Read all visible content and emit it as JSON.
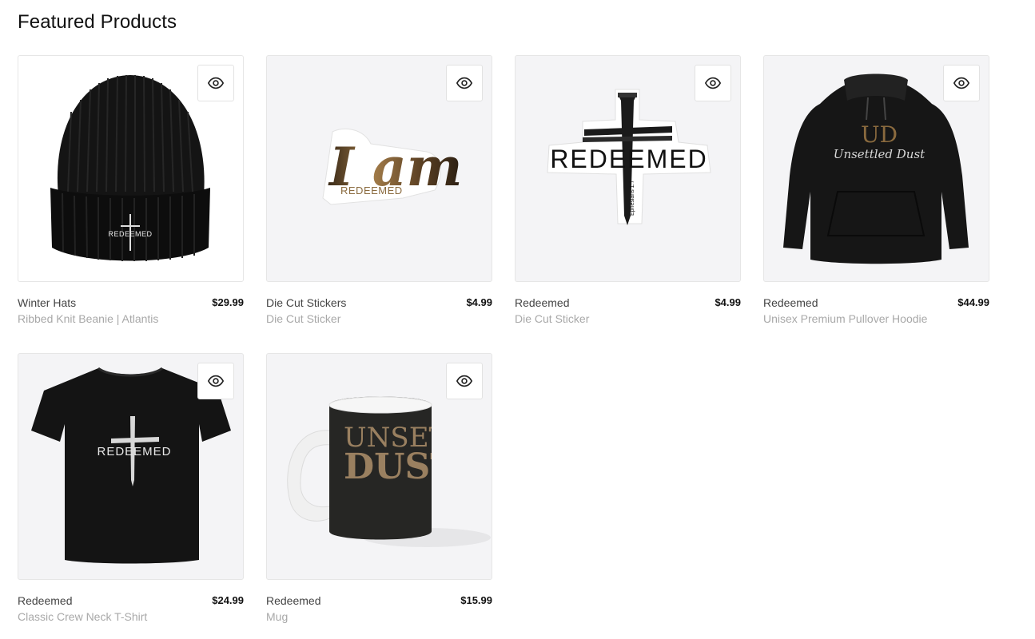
{
  "section": {
    "title": "Featured Products"
  },
  "quick_view_icon": "eye-icon",
  "products": [
    {
      "collection": "Winter Hats",
      "type": "Ribbed Knit Beanie | Atlantis",
      "price": "$29.99",
      "image": "black-beanie-redeemed",
      "art_text": "REDEEMED"
    },
    {
      "collection": "Die Cut Stickers",
      "type": "Die Cut Sticker",
      "price": "$4.99",
      "image": "i-am-redeemed-sticker",
      "art_text": "I am",
      "art_subtext": "REDEEMED"
    },
    {
      "collection": "Redeemed",
      "type": "Die Cut Sticker",
      "price": "$4.99",
      "image": "nail-cross-redeemed-sticker",
      "art_text": "REDEEMED",
      "art_subtext": "Ephesians 1:7"
    },
    {
      "collection": "Redeemed",
      "type": "Unisex Premium Pullover Hoodie",
      "price": "$44.99",
      "image": "black-hoodie-unsettled-dust",
      "art_text": "UD",
      "art_subtext": "Unsettled Dust"
    },
    {
      "collection": "Redeemed",
      "type": "Classic Crew Neck T-Shirt",
      "price": "$24.99",
      "image": "black-tshirt-redeemed",
      "art_text": "REDEEMED"
    },
    {
      "collection": "Redeemed",
      "type": "Mug",
      "price": "$15.99",
      "image": "black-mug-unsettled-dust",
      "art_text": "UNSETT",
      "art_subtext": "DUST"
    }
  ],
  "colors": {
    "gold": "#8a6a3e",
    "text_muted": "#a8a8a8"
  }
}
